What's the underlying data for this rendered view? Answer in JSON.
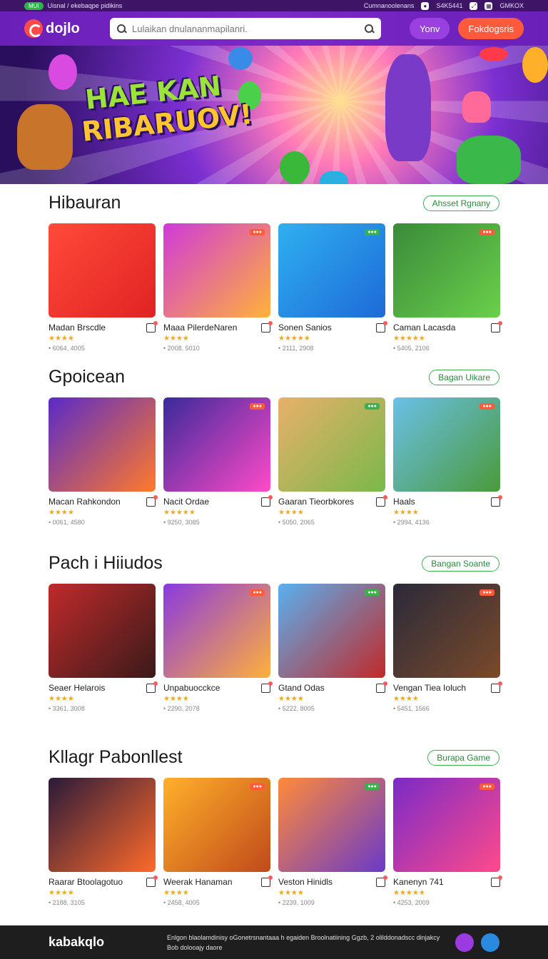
{
  "topbar": {
    "pill": "MUI",
    "left_text": "Uisnal / ekebaqpe pidikins",
    "right_text": "Cumnanoolenans",
    "right_code": "S4K5441",
    "right_extra": "GMKOX"
  },
  "header": {
    "logo": "dojlo",
    "search_placeholder": "Lulaikan dnulananmapilanri.",
    "btn_secondary": "Yonv",
    "btn_primary": "Fokdogsris"
  },
  "hero": {
    "line1": "HAE KAN",
    "line2": "RIBARUOV!"
  },
  "sections": [
    {
      "title": "Hibauran",
      "link": "Ahsset Rgnany",
      "items": [
        {
          "name": "Madan Brscdle",
          "stars": "★★★★",
          "count": "• 6064, 4005",
          "colors": [
            "#ff4a3a",
            "#e02323"
          ]
        },
        {
          "name": "Maaa PilerdeNaren",
          "stars": "★★★★",
          "count": "• 2008, 5010",
          "colors": [
            "#d03ad8",
            "#ffb23a"
          ]
        },
        {
          "name": "Sonen Sanios",
          "stars": "★★★★★",
          "count": "• 2111, 2908",
          "colors": [
            "#2fb0f0",
            "#1d6ad8"
          ]
        },
        {
          "name": "Caman Lacasda",
          "stars": "★★★★★",
          "count": "• 5405, 2106",
          "colors": [
            "#3a8a3a",
            "#6ad04a"
          ]
        }
      ]
    },
    {
      "title": "Gpoicean",
      "link": "Bagan Uikare",
      "items": [
        {
          "name": "Macan Rahkondon",
          "stars": "★★★★",
          "count": "• 0061, 4580",
          "colors": [
            "#5a2ac8",
            "#ff7a2a"
          ]
        },
        {
          "name": "Nacit Ordae",
          "stars": "★★★★★",
          "count": "• 9250, 3085",
          "colors": [
            "#3a2a9a",
            "#ff4ac8"
          ]
        },
        {
          "name": "Gaaran Tieorbkores",
          "stars": "★★★★",
          "count": "• 5050, 2065",
          "colors": [
            "#e8b06a",
            "#7ab84a"
          ]
        },
        {
          "name": "Haals",
          "stars": "★★★★",
          "count": "• 2994, 4136",
          "colors": [
            "#6ac0e8",
            "#4a9a3a"
          ]
        }
      ]
    },
    {
      "title": "Pach i Hiiudos",
      "link": "Bangan Soante",
      "items": [
        {
          "name": "Seaer Helarois",
          "stars": "★★★★",
          "count": "• 3361, 3008",
          "colors": [
            "#c02a2a",
            "#3a1a1a"
          ]
        },
        {
          "name": "Unpabuocckce",
          "stars": "★★★★",
          "count": "• 2290, 2078",
          "colors": [
            "#8a3ae0",
            "#ffb03a"
          ]
        },
        {
          "name": "Gtand Odas",
          "stars": "★★★★",
          "count": "• 5222, 8005",
          "colors": [
            "#5ab0f0",
            "#c02a2a"
          ]
        },
        {
          "name": "Vengan Tiea Ioluch",
          "stars": "★★★★",
          "count": "• 5451, 1566",
          "colors": [
            "#2a2a3a",
            "#7a4a2a"
          ]
        }
      ]
    },
    {
      "title": "Kllagr Pabonllest",
      "link": "Burapa Game",
      "items": [
        {
          "name": "Raarar Btoolagotuo",
          "stars": "★★★★",
          "count": "• 2188, 3105",
          "colors": [
            "#2a1a3a",
            "#ff6a2a"
          ]
        },
        {
          "name": "Weerak Hanaman",
          "stars": "★★★★",
          "count": "• 2458, 4005",
          "colors": [
            "#ffb02a",
            "#c04a1a"
          ]
        },
        {
          "name": "Veston Hinidls",
          "stars": "★★★★",
          "count": "• 2239, 1009",
          "colors": [
            "#ff8a3a",
            "#6a3ac8"
          ]
        },
        {
          "name": "Kanenyn 741",
          "stars": "★★★★★",
          "count": "• 4253, 2009",
          "colors": [
            "#7a2ac8",
            "#ff4a8a"
          ]
        }
      ]
    }
  ],
  "footer": {
    "logo": "kabakqlo",
    "text1": "Enlgon blaolamdinisy oGonetrsnantaaa h egaiden Broolnatiining Ggzb, 2 olilddonadscc dinjakcy",
    "text2": "Bob dolooajy daore"
  }
}
